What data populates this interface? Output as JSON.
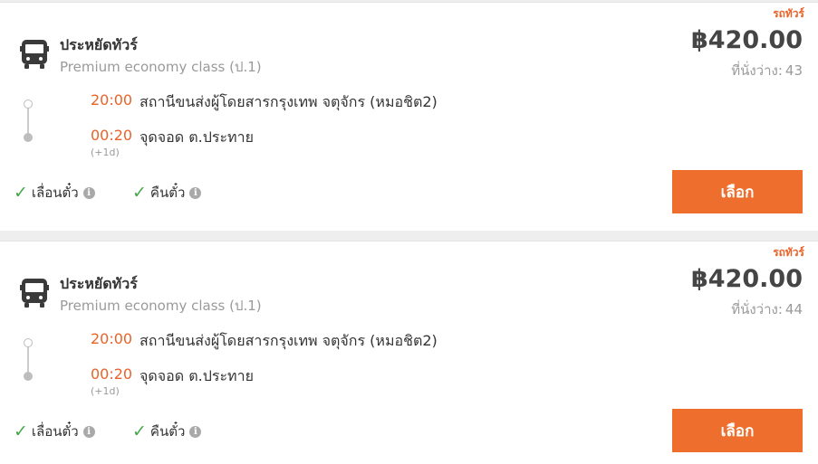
{
  "results": [
    {
      "tag": "รถทัวร์",
      "operator": "ประหยัดทัวร์",
      "bus_class": "Premium economy class (ป.1)",
      "price": "฿420.00",
      "seats_label": "ที่นั่งว่าง:",
      "seats_count": "43",
      "departure_time": "20:00",
      "departure_station": "สถานีขนส่งผู้โดยสารกรุงเทพ จตุจักร (หมอชิต2)",
      "arrival_time": "00:20",
      "arrival_station": "จุดจอด ต.ประทาย",
      "next_day": "(+1d)",
      "feature_1": "เลื่อนตั๋ว",
      "feature_2": "คืนตั๋ว",
      "select_label": "เลือก"
    },
    {
      "tag": "รถทัวร์",
      "operator": "ประหยัดทัวร์",
      "bus_class": "Premium economy class (ป.1)",
      "price": "฿420.00",
      "seats_label": "ที่นั่งว่าง:",
      "seats_count": "44",
      "departure_time": "20:00",
      "departure_station": "สถานีขนส่งผู้โดยสารกรุงเทพ จตุจักร (หมอชิต2)",
      "arrival_time": "00:20",
      "arrival_station": "จุดจอด ต.ประทาย",
      "next_day": "(+1d)",
      "feature_1": "เลื่อนตั๋ว",
      "feature_2": "คืนตั๋ว",
      "select_label": "เลือก"
    }
  ],
  "icons": {
    "bus": "bus-icon",
    "check": "check-icon",
    "info": "info-icon",
    "timeline_start": "circle-outline",
    "timeline_end": "circle-filled"
  },
  "colors": {
    "accent": "#ee6f2d",
    "time": "#e8632a",
    "check": "#46a84b",
    "price": "#454545",
    "muted": "#9a9a9a"
  }
}
